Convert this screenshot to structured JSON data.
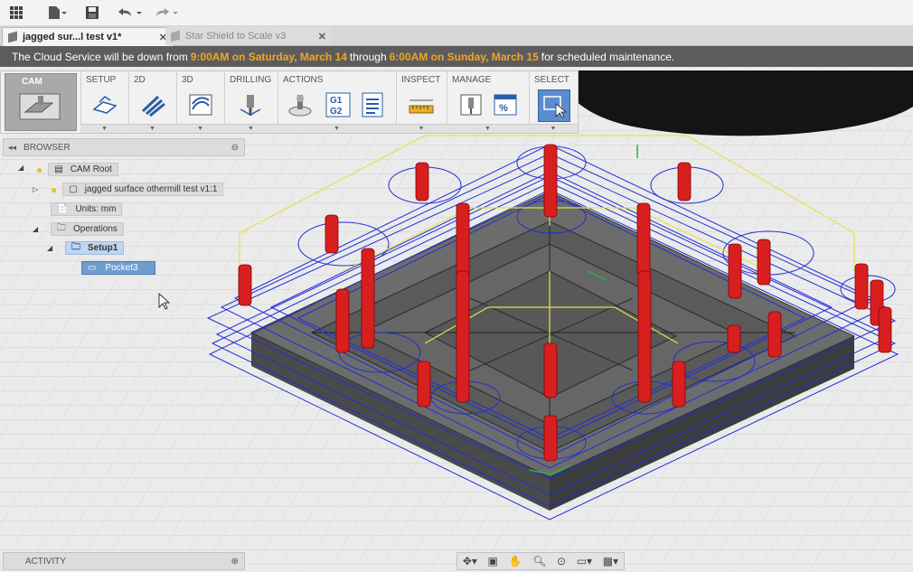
{
  "tabs": [
    {
      "label": "jagged sur...l test v1*",
      "active": true
    },
    {
      "label": "Star Shield to Scale v3",
      "active": false
    }
  ],
  "banner": {
    "pre": "The Cloud Service will be down from",
    "start": "9:00AM on Saturday, March 14",
    "mid": "through",
    "end": "6:00AM on Sunday, March 15",
    "post": "for scheduled maintenance."
  },
  "ribbon": {
    "workspace": "CAM",
    "groups": [
      "SETUP",
      "2D",
      "3D",
      "DRILLING",
      "ACTIONS",
      "INSPECT",
      "MANAGE",
      "SELECT"
    ]
  },
  "browser": {
    "title": "BROWSER",
    "nodes": {
      "root": "CAM Root",
      "model": "jagged surface othermill test v1:1",
      "units": "Units: mm",
      "operations": "Operations",
      "setup": "Setup1",
      "pocket": "Pocket3"
    }
  },
  "activity": {
    "title": "ACTIVITY"
  },
  "colors": {
    "toolpath": "#1f2fd6",
    "tool": "#d81f1f",
    "link": "#e8e04a",
    "part": "#5a5a5a",
    "banner_highlight": "#f0a524"
  }
}
